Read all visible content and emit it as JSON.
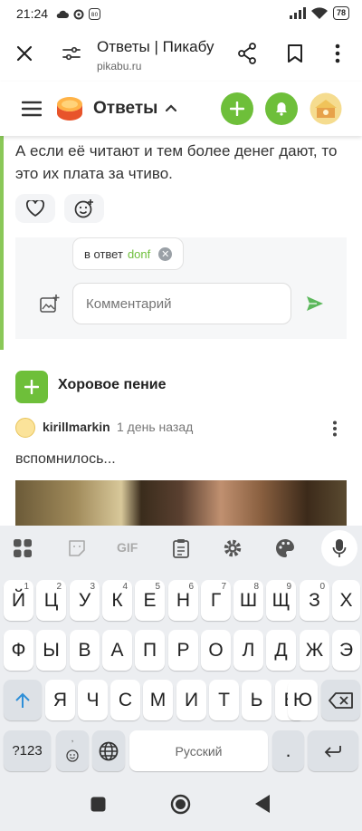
{
  "status_bar": {
    "time": "21:24",
    "battery": "78"
  },
  "browser": {
    "title": "Ответы | Пикабу",
    "url": "pikabu.ru"
  },
  "site_header": {
    "section": "Ответы"
  },
  "comment": {
    "text": "А если её читают и тем более денег дают, то это их плата за чтиво."
  },
  "reply": {
    "prefix": "в ответ",
    "user": "donf",
    "placeholder": "Комментарий"
  },
  "post": {
    "title": "Хоровое пение",
    "author": "kirillmarkin",
    "date": "1 день назад",
    "text": "вспомнилось..."
  },
  "keyboard": {
    "toolbar_gif": "GIF",
    "row1": [
      {
        "k": "Й",
        "h": "1"
      },
      {
        "k": "Ц",
        "h": "2"
      },
      {
        "k": "У",
        "h": "3"
      },
      {
        "k": "К",
        "h": "4"
      },
      {
        "k": "Е",
        "h": "5"
      },
      {
        "k": "Н",
        "h": "6"
      },
      {
        "k": "Г",
        "h": "7"
      },
      {
        "k": "Ш",
        "h": "8"
      },
      {
        "k": "Щ",
        "h": "9"
      },
      {
        "k": "З",
        "h": "0"
      },
      {
        "k": "Х",
        "h": ""
      }
    ],
    "row2": [
      "Ф",
      "Ы",
      "В",
      "А",
      "П",
      "Р",
      "О",
      "Л",
      "Д",
      "Ж",
      "Э"
    ],
    "row3": [
      "Я",
      "Ч",
      "С",
      "М",
      "И",
      "Т",
      "Ь",
      "Б",
      "Ю"
    ],
    "symbols_key": "?123",
    "space_label": "Русский",
    "period": ".",
    "emoji_hint": ","
  },
  "colors": {
    "accent_green": "#6ebf3a",
    "link_green": "#6ebf3a",
    "send_green": "#5cb85c"
  }
}
